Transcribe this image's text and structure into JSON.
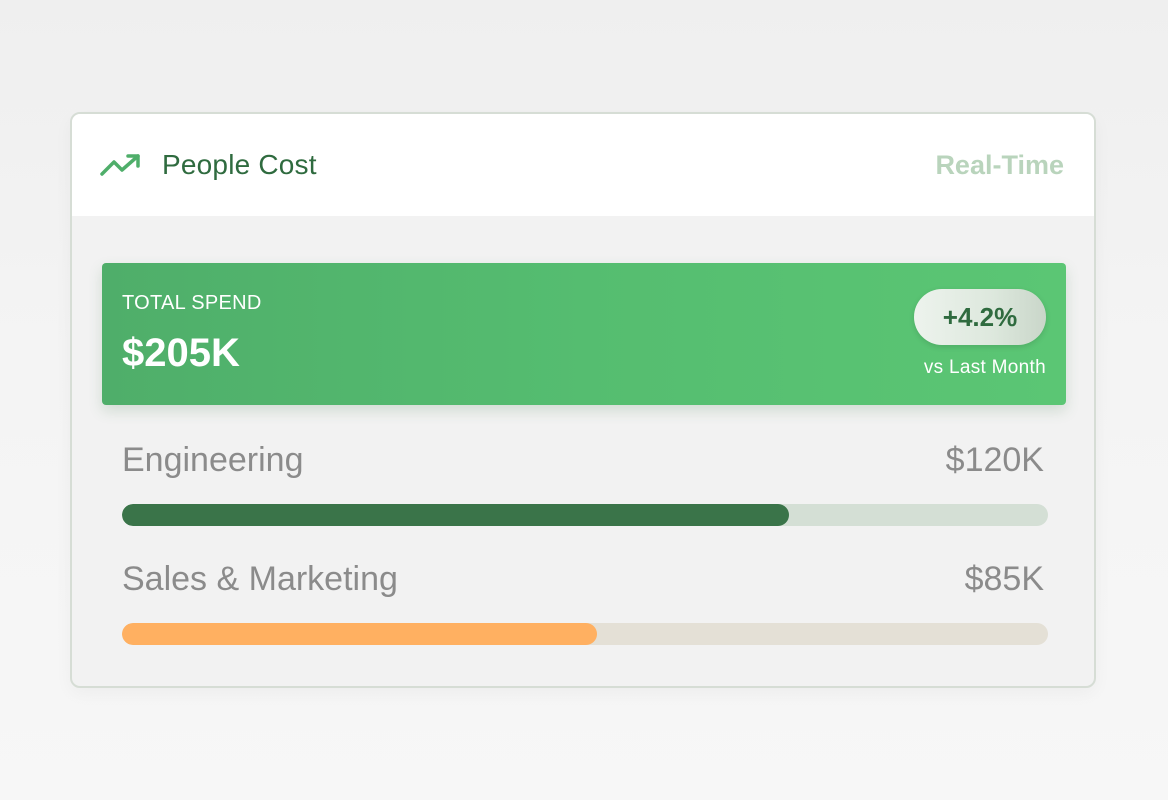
{
  "header": {
    "title": "People Cost",
    "status": "Real-Time",
    "icon": "trending-up-icon"
  },
  "summary": {
    "label": "TOTAL SPEND",
    "value": "$205K",
    "change": "+4.2%",
    "change_caption": "vs Last Month"
  },
  "breakdown": [
    {
      "label": "Engineering",
      "value": "$120K",
      "progress": 0.72,
      "color": "#3a7449",
      "track_color": "#d4dfd5"
    },
    {
      "label": "Sales & Marketing",
      "value": "$85K",
      "progress": 0.513,
      "color": "#ffb061",
      "track_color": "#e4e0d6"
    }
  ],
  "colors": {
    "accent": "#4fae6a",
    "title_text": "#2f6b3f",
    "status_text": "#b9d4bc"
  }
}
